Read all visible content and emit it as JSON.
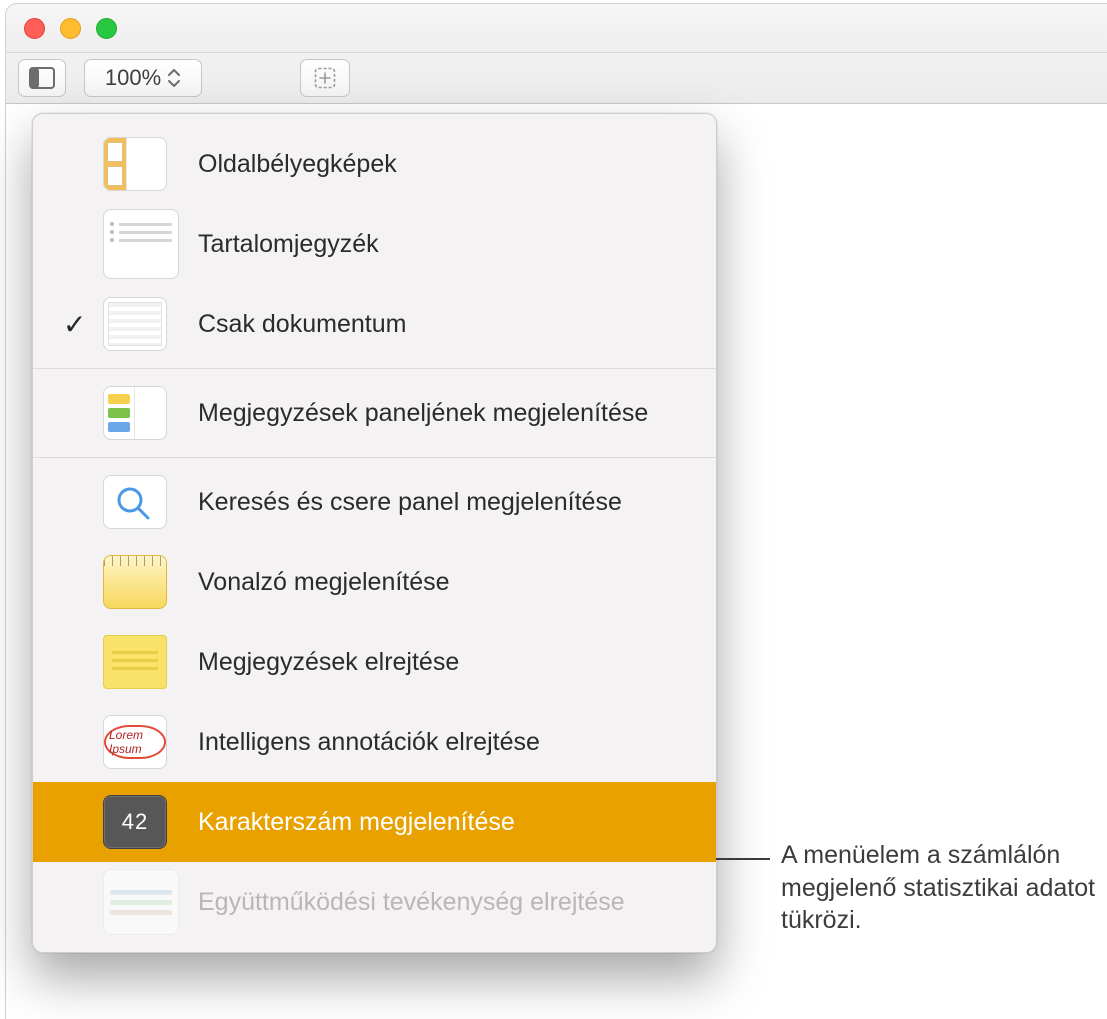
{
  "toolbar": {
    "zoom": "100%"
  },
  "menu": {
    "thumbnails": "Oldalbélyegképek",
    "toc": "Tartalomjegyzék",
    "doc_only": "Csak dokumentum",
    "show_comments_panel": "Megjegyzések paneljének megjelenítése",
    "show_find_replace": "Keresés és csere panel megjelenítése",
    "show_ruler": "Vonalzó megjelenítése",
    "hide_comments": "Megjegyzések elrejtése",
    "hide_smart_annot": "Intelligens annotációk elrejtése",
    "show_char_count": "Karakterszám megjelenítése",
    "hide_collab_activity": "Együttműködési tevékenység elrejtése"
  },
  "icons": {
    "count_value": "42",
    "annot_label": "Lorem Ipsum"
  },
  "callout": "A menüelem a számlálón megjelenő statisztikai adatot tükrözi."
}
